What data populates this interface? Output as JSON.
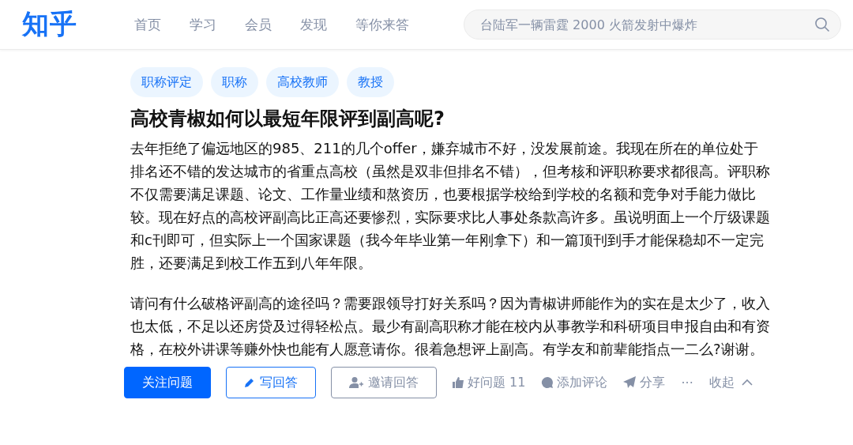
{
  "header": {
    "logo": "知乎",
    "nav": [
      {
        "label": "首页",
        "selected": false
      },
      {
        "label": "学习",
        "selected": false
      },
      {
        "label": "会员",
        "selected": false
      },
      {
        "label": "发现",
        "selected": false
      },
      {
        "label": "等你来答",
        "selected": false
      }
    ],
    "search": {
      "placeholder": "台陆军一辆雷霆 2000 火箭发射中爆炸"
    }
  },
  "question": {
    "tags": [
      "职称评定",
      "职称",
      "高校教师",
      "教授"
    ],
    "title": "高校青椒如何以最短年限评到副高呢?",
    "paragraphs": [
      "去年拒绝了偏远地区的985、211的几个offer，嫌弃城市不好，没发展前途。我现在所在的单位处于排名还不错的发达城市的省重点高校（虽然是双非但排名不错），但考核和评职称要求都很高。评职称不仅需要满足课题、论文、工作量业绩和熬资历，也要根据学校给到学校的名额和竞争对手能力做比较。现在好点的高校评副高比正高还要惨烈，实际要求比人事处条款高许多。虽说明面上一个厅级课题和c刊即可，但实际上一个国家课题（我今年毕业第一年刚拿下）和一篇顶刊到手才能保稳却不一定完胜，还要满足到校工作五到八年年限。",
      "请问有什么破格评副高的途径吗？需要跟领导打好关系吗？因为青椒讲师能作为的实在是太少了，收入也太低，不足以还房贷及过得轻松点。最少有副高职称才能在校内从事教学和科研项目申报自由和有资格，在校外讲课等赚外快也能有人愿意请你。很着急想评上副高。有学友和前辈能指点一二么?谢谢。"
    ],
    "buttons": [
      {
        "kind": "primary",
        "label": "关注问题"
      },
      {
        "kind": "write",
        "label": "写回答"
      },
      {
        "kind": "invite",
        "label": "邀请回答"
      }
    ],
    "actions": [
      {
        "kind": "like",
        "label": "好问题 11"
      },
      {
        "kind": "comment",
        "label": "添加评论"
      },
      {
        "kind": "share",
        "label": "分享"
      },
      {
        "kind": "more",
        "label": "···"
      },
      {
        "kind": "collapse",
        "label": "收起"
      }
    ]
  }
}
